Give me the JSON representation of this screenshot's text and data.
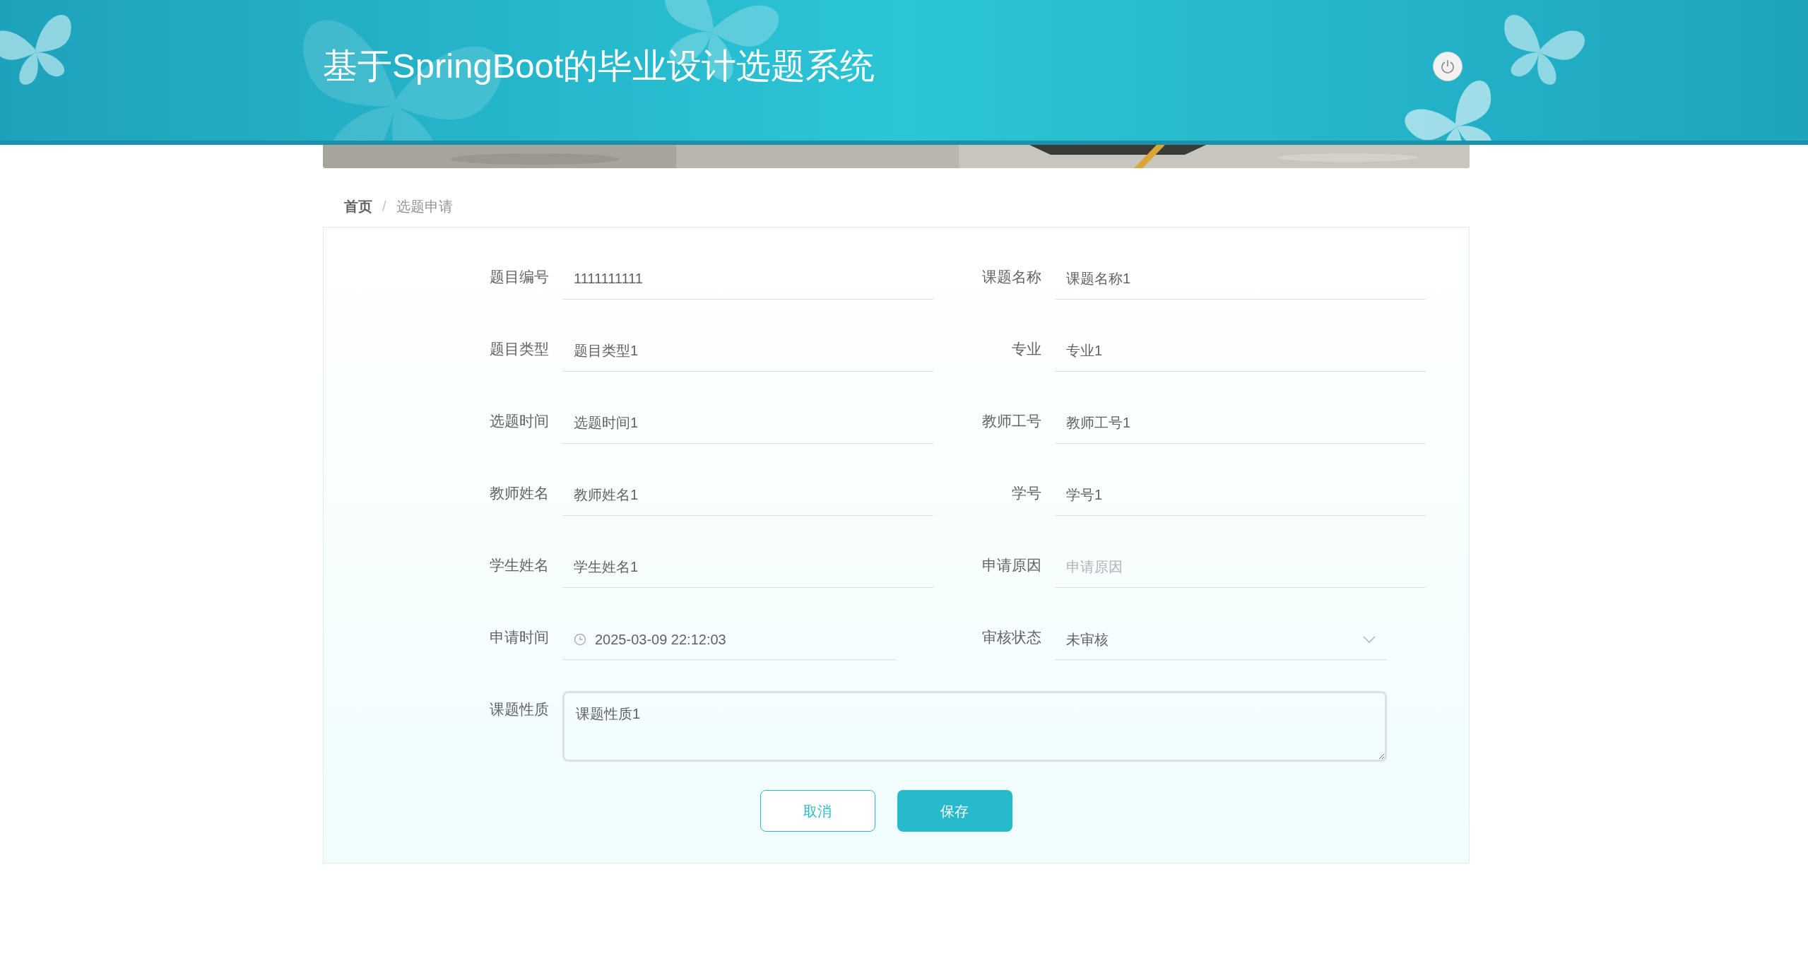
{
  "header": {
    "title": "基于SpringBoot的毕业设计选题系统"
  },
  "breadcrumb_separator": "/",
  "breadcrumb": [
    {
      "label": "首页",
      "current": false
    },
    {
      "label": "选题申请",
      "current": true
    }
  ],
  "form": {
    "fields": [
      {
        "label": "题目编号",
        "kind": "text",
        "value": "1111111111"
      },
      {
        "label": "课题名称",
        "kind": "text",
        "value": "课题名称1"
      },
      {
        "label": "题目类型",
        "kind": "text",
        "value": "题目类型1"
      },
      {
        "label": "专业",
        "kind": "text",
        "value": "专业1"
      },
      {
        "label": "选题时间",
        "kind": "text",
        "value": "选题时间1"
      },
      {
        "label": "教师工号",
        "kind": "text",
        "value": "教师工号1"
      },
      {
        "label": "教师姓名",
        "kind": "text",
        "value": "教师姓名1"
      },
      {
        "label": "学号",
        "kind": "text",
        "value": "学号1"
      },
      {
        "label": "学生姓名",
        "kind": "text",
        "value": "学生姓名1"
      },
      {
        "label": "申请原因",
        "kind": "text",
        "placeholder": "申请原因"
      },
      {
        "label": "申请时间",
        "kind": "date",
        "value": "2025-03-09 22:12:03"
      },
      {
        "label": "审核状态",
        "kind": "select",
        "value": "未审核"
      },
      {
        "label": "课题性质",
        "kind": "textarea",
        "value": "课题性质1"
      }
    ],
    "buttons": [
      {
        "label": "取消",
        "kind": "secondary"
      },
      {
        "label": "保存",
        "kind": "primary"
      }
    ]
  }
}
